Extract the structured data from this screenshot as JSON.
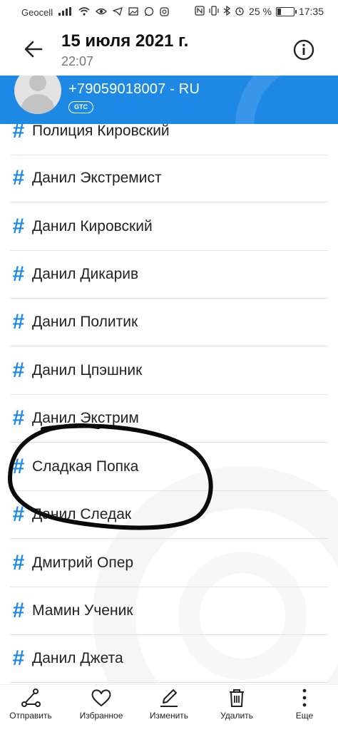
{
  "status_bar": {
    "carrier": "Geocell",
    "battery": "25 %",
    "time": "17:35"
  },
  "header": {
    "title": "15 июля 2021 г.",
    "subtitle": "22:07",
    "back_icon": "arrow-left-icon",
    "info_icon": "info-circle-icon"
  },
  "contact": {
    "phone": "+79059018007 - RU",
    "badge": "GTC"
  },
  "list": {
    "items": [
      {
        "label": "Полиция Кировский"
      },
      {
        "label": "Данил Экстремист"
      },
      {
        "label": "Данил Кировский"
      },
      {
        "label": "Данил Дикарив"
      },
      {
        "label": "Данил Политик"
      },
      {
        "label": "Данил Цпэшник"
      },
      {
        "label": "Данил Экстрим"
      },
      {
        "label": "Сладкая Попка"
      },
      {
        "label": "Данил Следак"
      },
      {
        "label": "Дмитрий Опер"
      },
      {
        "label": "Мамин Ученик"
      },
      {
        "label": "Данил Джета"
      }
    ]
  },
  "bottom_bar": {
    "send": "Отправить",
    "favorite": "Избранное",
    "edit": "Изменить",
    "delete": "Удалить",
    "more": "Еще"
  },
  "colors": {
    "accent": "#1e88e5",
    "scribble": "#0a0a0a"
  }
}
